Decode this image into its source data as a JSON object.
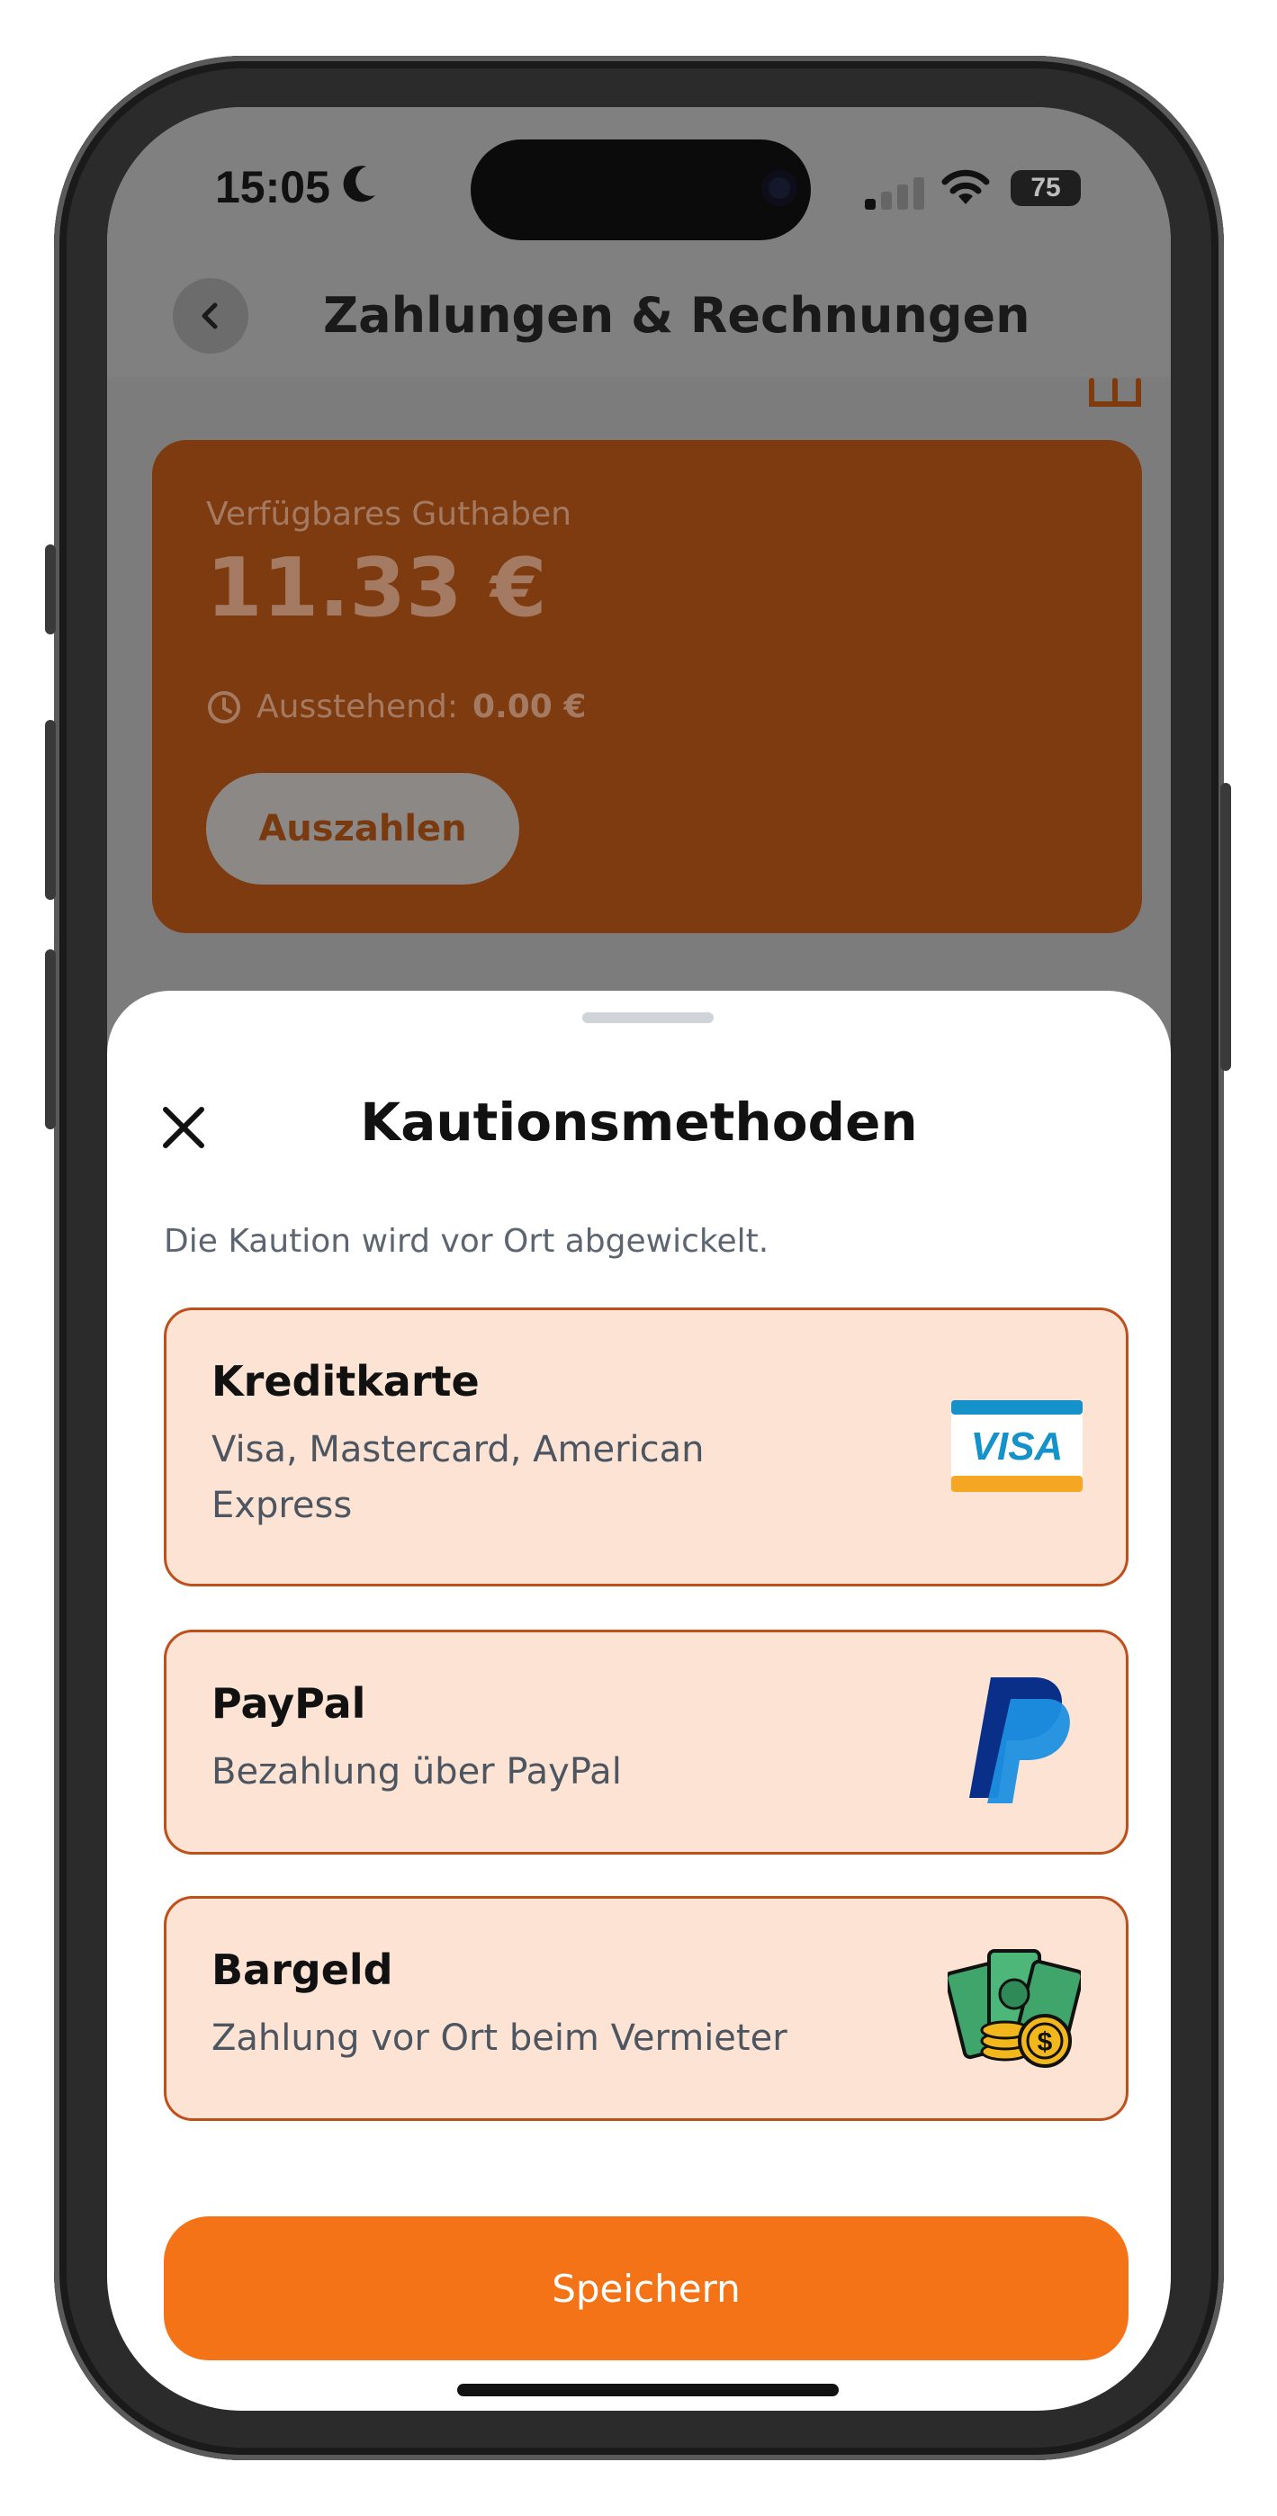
{
  "status_bar": {
    "time": "15:05",
    "battery": "75"
  },
  "header": {
    "title": "Zahlungen & Rechnungen"
  },
  "balance": {
    "label": "Verfügbares Guthaben",
    "amount": "11.33 €",
    "pending_label": "Ausstehend:",
    "pending_value": "0.00 €",
    "payout_label": "Auszahlen"
  },
  "sheet": {
    "title": "Kautionsmethoden",
    "subtitle": "Die Kaution wird vor Ort abgewickelt.",
    "methods": [
      {
        "title": "Kreditkarte",
        "description": "Visa, Mastercard, American Express",
        "icon": "visa-card-icon"
      },
      {
        "title": "PayPal",
        "description": "Bezahlung über PayPal",
        "icon": "paypal-icon"
      },
      {
        "title": "Bargeld",
        "description": "Zahlung vor Ort beim Vermieter",
        "icon": "cash-icon"
      }
    ],
    "save_label": "Speichern",
    "visa_text": "VISA"
  },
  "colors": {
    "accent": "#f57317",
    "card_bg": "#fce3d3",
    "card_border": "#c0501a",
    "balance_card": "#7d3b0f"
  }
}
